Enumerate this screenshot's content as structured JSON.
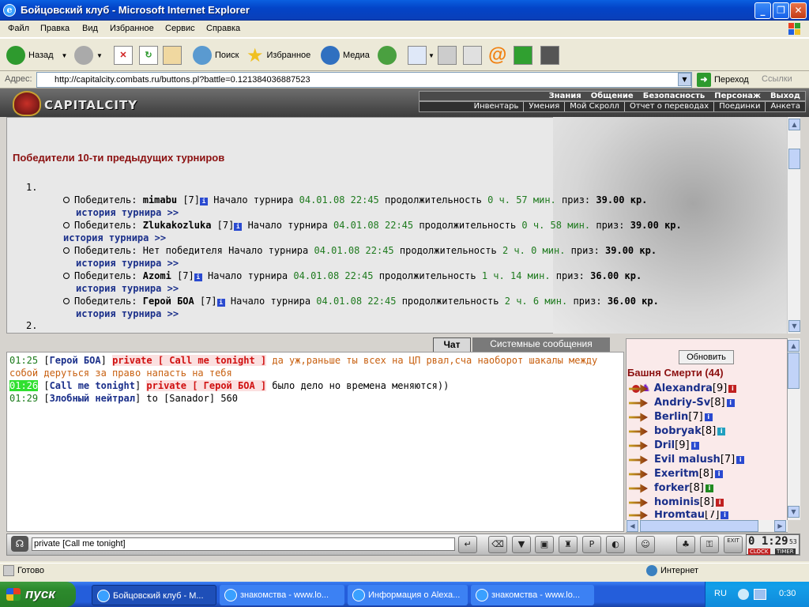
{
  "window": {
    "title": "Бойцовский клуб - Microsoft Internet Explorer"
  },
  "menu": [
    "Файл",
    "Правка",
    "Вид",
    "Избранное",
    "Сервис",
    "Справка"
  ],
  "toolbar": {
    "back": "Назад",
    "search": "Поиск",
    "favorites": "Избранное",
    "media": "Медиа"
  },
  "address": {
    "label": "Адрес:",
    "url": "http://capitalcity.combats.ru/buttons.pl?battle=0.121384036887523",
    "go": "Переход",
    "links": "Ссылки"
  },
  "game": {
    "logo": "CAPITALCITY",
    "nav_top": [
      "Знания",
      "Общение",
      "Безопасность",
      "Персонаж",
      "Выход"
    ],
    "nav_bottom": [
      "Инвентарь",
      "Умения",
      "Мой Скролл",
      "Отчет о переводах",
      "Поединки",
      "Анкета"
    ]
  },
  "tournaments": {
    "title": "Победители 10-ти предыдущих турниров",
    "num1": "1.",
    "num2": "2.",
    "labels": {
      "winner": "Победитель:",
      "start": "Начало турнира",
      "duration": "продолжительность",
      "prize": "приз:",
      "history": "история турнира >>"
    },
    "rows": [
      {
        "winner": "mimabu",
        "level": "[7]",
        "date": "04.01.08 22:45",
        "duration": "0 ч. 57 мин.",
        "prize": "39.00 кр."
      },
      {
        "winner": "Zlukakozluka",
        "level": "[7]",
        "date": "04.01.08 22:45",
        "duration": "0 ч. 58 мин.",
        "prize": "39.00 кр."
      },
      {
        "winner": "Нет победителя",
        "level": "",
        "date": "04.01.08 22:45",
        "duration": "2 ч. 0 мин.",
        "prize": "39.00 кр."
      },
      {
        "winner": "Azomi",
        "level": "[7]",
        "date": "04.01.08 22:45",
        "duration": "1 ч. 14 мин.",
        "prize": "36.00 кр."
      },
      {
        "winner": "Герой БОА",
        "level": "[7]",
        "date": "04.01.08 22:45",
        "duration": "2 ч. 6 мин.",
        "prize": "36.00 кр."
      }
    ]
  },
  "tabs": {
    "chat": "Чат",
    "system": "Системные сообщения"
  },
  "chat": [
    {
      "time": "01:25",
      "from": "Герой БОА",
      "private": "private [ Call me tonight ]",
      "text": "да уж,раньше ты всех на ЦП рвал,сча наоборот шакалы между собой деруться за право напасть на тебя"
    },
    {
      "time": "01:26",
      "from": "Call me tonight",
      "private": "private [ Герой БОА ]",
      "text": "было дело но времена меняются))"
    },
    {
      "time": "01:29",
      "from": "Злобный нейтрал",
      "text": "to [Sanador] 560"
    }
  ],
  "online": {
    "refresh": "Обновить",
    "room": "Башня Смерти (44)",
    "players": [
      {
        "name": "Alexandra",
        "level": "[9]"
      },
      {
        "name": "Andriy-Sv",
        "level": "[8]"
      },
      {
        "name": "Berlin",
        "level": "[7]"
      },
      {
        "name": "bobryak",
        "level": "[8]"
      },
      {
        "name": "Dril",
        "level": "[9]"
      },
      {
        "name": "Evil malush",
        "level": "[7]"
      },
      {
        "name": "Exeritm",
        "level": "[8]"
      },
      {
        "name": "forker",
        "level": "[8]"
      },
      {
        "name": "hominis",
        "level": "[8]"
      },
      {
        "name": "Hromtau",
        "level": "[7]"
      }
    ]
  },
  "input": {
    "value": "private [Call me tonight]"
  },
  "clock": {
    "time": "0 1:29",
    "sec": "53",
    "clock_label": "CLOCK",
    "timer_label": "TIMER",
    "exit": "EXIT"
  },
  "status": {
    "text": "Готово",
    "zone": "Интернет"
  },
  "taskbar": {
    "start": "пуск",
    "tasks": [
      "Бойцовский клуб - M...",
      "знакомства - www.lo...",
      "Информация о Alexa...",
      "знакомства - www.lo..."
    ],
    "lang": "RU",
    "time": "0:30"
  }
}
